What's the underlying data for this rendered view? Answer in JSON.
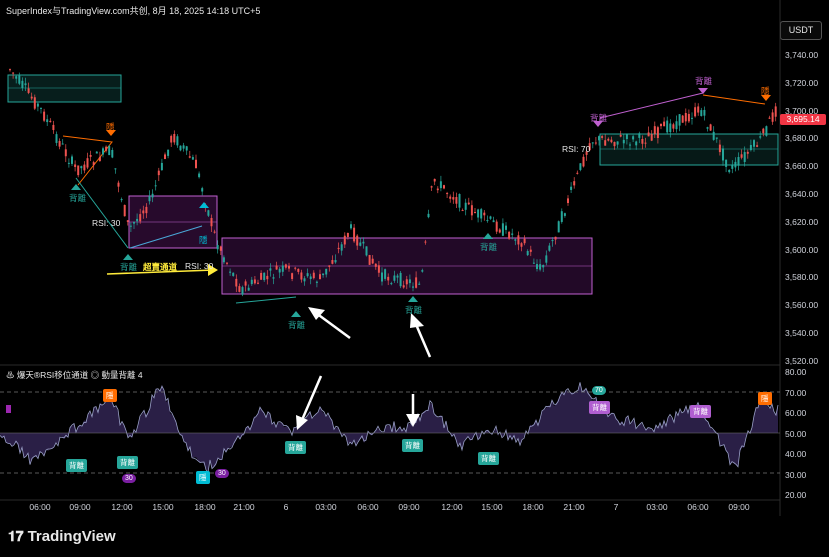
{
  "header": {
    "title": "SuperIndex与TradingView.com共创, 8月 18, 2025 14:18 UTC+5"
  },
  "currency_button": "USDT",
  "price_axis": [
    "3,740.00",
    "3,720.00",
    "3,700.00",
    "3,680.00",
    "3,660.00",
    "3,640.00",
    "3,620.00",
    "3,600.00",
    "3,580.00",
    "3,560.00",
    "3,540.00",
    "3,520.00"
  ],
  "last_price": "3,695.14",
  "oscillator": {
    "legend": "♨ 爆天®RSI移位通道 ◎ 動量背離 4",
    "axis": [
      "80.00",
      "70.00",
      "60.00",
      "50.00",
      "40.00",
      "30.00",
      "20.00"
    ]
  },
  "time_axis": [
    "06:00",
    "09:00",
    "12:00",
    "15:00",
    "18:00",
    "21:00",
    "6",
    "03:00",
    "06:00",
    "09:00",
    "12:00",
    "15:00",
    "18:00",
    "21:00",
    "7",
    "03:00",
    "06:00",
    "09:00"
  ],
  "annotations": {
    "divergence": "背離",
    "hidden": "隱",
    "rsi30": "RSI: 30",
    "rsi70": "RSI: 70",
    "oversold_channel": "超賣通道",
    "osc30": "30",
    "osc70": "70"
  },
  "brand": "TradingView",
  "colors": {
    "bull": "#26a69a",
    "bear": "#ef5350",
    "purple": "#9c27b0",
    "green_box": "#26a69a",
    "orange": "#ff6d00",
    "cyan": "#00bcd4",
    "yellow": "#ffeb3b"
  }
}
